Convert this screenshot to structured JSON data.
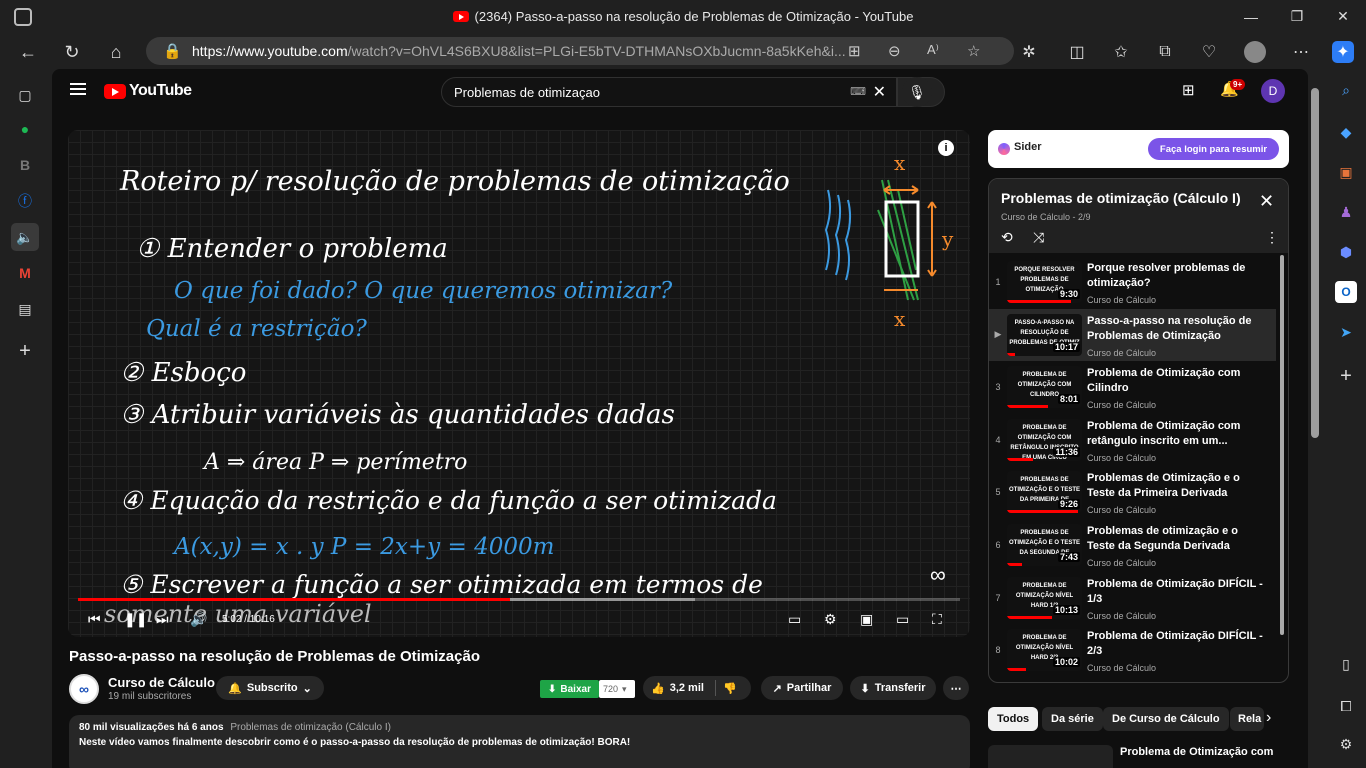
{
  "browser": {
    "window_title": "(2364) Passo-a-passo na resolução de Problemas de Otimização - YouTube",
    "url_host": "https://www.youtube.com",
    "url_path": "/watch?v=OhVL4S6BXU8&list=PLGi-E5bTV-DTHMANsOXbJucmn-8a5kKeh&i..."
  },
  "youtube": {
    "logo_text": "YouTube",
    "search_value": "Problemas de otimizaçao",
    "notif_badge": "9+",
    "avatar_letter": "D"
  },
  "player": {
    "time": "5:02 / 10:16",
    "progress_fraction": 0.49,
    "board": {
      "heading": "Roteiro p/ resolução de problemas de otimização",
      "step1": "① Entender o problema",
      "step1_q": "O que foi dado? O que queremos otimizar?",
      "step1_q2": "Qual é a restrição?",
      "step2": "② Esboço",
      "step3": "③ Atribuir variáveis às quantidades dadas",
      "step3_sub": "A ⇒ área      P ⇒ perímetro",
      "step4": "④ Equação da restrição e da função a ser otimizada",
      "step4_eq": "A(x,y) = x . y        P = 2x+y = 4000m",
      "step5": "⑤ Escrever a função a ser otimizada em termos de",
      "step5_b": "somente uma variável",
      "diag_x_top": "x",
      "diag_y": "y",
      "diag_x_bottom": "x"
    }
  },
  "video": {
    "title": "Passo-a-passo na resolução de Problemas de Otimização",
    "channel": "Curso de Cálculo",
    "subscribers": "19 mil subscritores",
    "subscribe_label": "Subscrito",
    "download_label": "Baixar",
    "quality": "720",
    "likes": "3,2 mil",
    "share_label": "Partilhar",
    "transfer_label": "Transferir",
    "views_line": "80 mil visualizações  há 6 anos",
    "playlist_link": "Problemas de otimização (Cálculo I)",
    "description": "Neste vídeo vamos finalmente descobrir como é o passo-a-passo da resolução de problemas de otimização! BORA!"
  },
  "sider": {
    "name": "Sider",
    "login_label": "Faça login para resumir"
  },
  "playlist": {
    "title": "Problemas de otimização (Cálculo I)",
    "subtitle": "Curso de Cálculo - 2/9",
    "items": [
      {
        "index": "1",
        "thumb": "Porque resolver problemas de otimização",
        "duration": "9:30",
        "watched": 0.85,
        "title": "Porque resolver problemas de otimização?",
        "channel": "Curso de Cálculo"
      },
      {
        "index": "▶",
        "thumb": "Passo-a-passo na resolução de problemas de otimiz",
        "duration": "10:17",
        "watched": 0.1,
        "title": "Passo-a-passo na resolução de Problemas de Otimização",
        "channel": "Curso de Cálculo"
      },
      {
        "index": "3",
        "thumb": "Problema de otimização com cilindro",
        "duration": "8:01",
        "watched": 0.55,
        "title": "Problema de Otimização com Cilindro",
        "channel": "Curso de Cálculo"
      },
      {
        "index": "4",
        "thumb": "Problema de otimização com retângulo inscrito em uma circu",
        "duration": "11:36",
        "watched": 0.35,
        "title": "Problema de Otimização com retângulo inscrito em um...",
        "channel": "Curso de Cálculo"
      },
      {
        "index": "5",
        "thumb": "Problemas de otimização e o teste da primeira de",
        "duration": "9:26",
        "watched": 0.95,
        "title": "Problemas de Otimização e o Teste da Primeira Derivada",
        "channel": "Curso de Cálculo"
      },
      {
        "index": "6",
        "thumb": "Problemas de otimização e o teste da segunda de",
        "duration": "7:43",
        "watched": 0.2,
        "title": "Problemas de otimização e o Teste da Segunda Derivada",
        "channel": "Curso de Cálculo"
      },
      {
        "index": "7",
        "thumb": "Problema de otimização nível hard 1/3",
        "duration": "10:13",
        "watched": 0.6,
        "title": "Problema de Otimização DIFÍCIL - 1/3",
        "channel": "Curso de Cálculo"
      },
      {
        "index": "8",
        "thumb": "Problema de otimização nível hard 2/3",
        "duration": "10:02",
        "watched": 0.25,
        "title": "Problema de Otimização DIFÍCIL - 2/3",
        "channel": "Curso de Cálculo"
      }
    ]
  },
  "chips": [
    "Todos",
    "Da série",
    "De Curso de Cálculo",
    "Rela"
  ],
  "next_video_title": "Problema de Otimização com"
}
